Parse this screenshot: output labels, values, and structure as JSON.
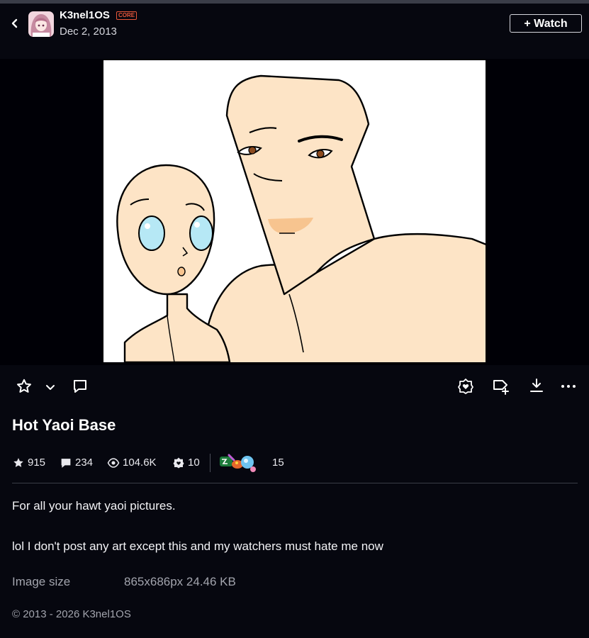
{
  "header": {
    "username": "K3nel1OS",
    "badge": "CORE",
    "date": "Dec 2, 2013",
    "watch_label": "+ Watch"
  },
  "icons": {
    "back": "chevron-left-icon",
    "favourite": "star-outline-icon",
    "favourite_menu": "chevron-down-icon",
    "comment": "comment-icon",
    "badge_give": "badge-heart-icon",
    "tag_add": "tag-plus-icon",
    "download": "download-icon",
    "more": "more-dots-icon",
    "stat_favourites": "star-filled-icon",
    "stat_comments": "comment-filled-icon",
    "stat_views": "eye-icon",
    "stat_badges": "badge-icon",
    "stat_awards": "awards-cluster-icon"
  },
  "deviation": {
    "title": "Hot Yaoi Base",
    "stats": {
      "favourites": "915",
      "comments": "234",
      "views": "104.6K",
      "badges": "10",
      "awards": "15"
    },
    "description": [
      "For all your hawt yaoi pictures.",
      "lol I don't post any art except this and my watchers must hate me now"
    ],
    "image_size_label": "Image size",
    "image_size_value": "865x686px 24.46 KB",
    "copyright": "© 2013 - 2026 K3nel1OS"
  },
  "colors": {
    "background": "#06070f",
    "core_badge": "#e8573a",
    "skin": "#fde4c6",
    "eye_blue": "#b6e8f5",
    "eye_brown": "#8b4a1e",
    "lips": "#f7c48f"
  }
}
